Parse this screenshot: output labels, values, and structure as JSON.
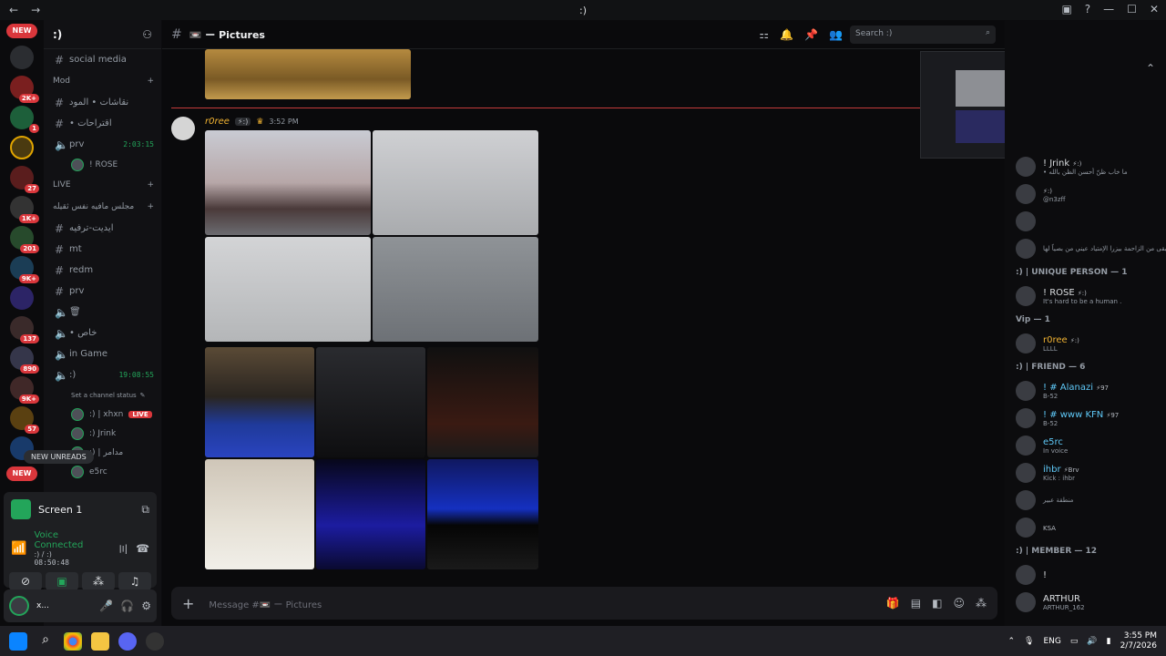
{
  "window": {
    "title": ":)",
    "back": "←",
    "forward": "→"
  },
  "servers": {
    "new_label": "NEW",
    "badges": [
      "2K+",
      "1",
      "27",
      "1K+",
      "201",
      "9K+",
      "137",
      "890",
      "9K+",
      "57"
    ]
  },
  "sidebar": {
    "server_name": ":)",
    "items": [
      {
        "type": "channel",
        "icon": "#",
        "name": "social media"
      },
      {
        "type": "category",
        "name": "Mod"
      },
      {
        "type": "channel",
        "icon": "#",
        "name": "نقاشات • المود"
      },
      {
        "type": "channel",
        "icon": "#",
        "name": "• اقتراحات"
      },
      {
        "type": "voice",
        "name": "prv",
        "time": "2:03:15"
      },
      {
        "type": "vuser",
        "name": "! ROSE"
      },
      {
        "type": "category",
        "name": "LIVE"
      },
      {
        "type": "category",
        "name": "مجلس مافيه نفس ثقيله"
      },
      {
        "type": "channel",
        "icon": "#",
        "name": "ايديت-ترفيه"
      },
      {
        "type": "channel",
        "icon": "#",
        "name": "mt"
      },
      {
        "type": "channel",
        "icon": "#",
        "name": "redm"
      },
      {
        "type": "channel",
        "icon": "#",
        "name": "prv"
      },
      {
        "type": "voice",
        "name": "🗑"
      },
      {
        "type": "voice",
        "name": "• خاص"
      },
      {
        "type": "voice",
        "name": "in Game"
      },
      {
        "type": "voice",
        "name": ":)",
        "time": "19:08:55"
      },
      {
        "type": "status",
        "name": "Set a channel status"
      },
      {
        "type": "vuser",
        "name": ":) | xhxn",
        "live": "LIVE"
      },
      {
        "type": "vuser",
        "name": ":) Jrink"
      },
      {
        "type": "vuser",
        "name": ":) | مدامر"
      },
      {
        "type": "vuser",
        "name": "e5rc"
      }
    ],
    "new_unreads": "NEW UNREADS"
  },
  "voice": {
    "screen_label": "Screen 1",
    "status": "Voice Connected",
    "channel": ":) / :)",
    "timer": "08:50:48"
  },
  "user": {
    "name": "x..."
  },
  "channel": {
    "name": "📼 ー Pictures",
    "search_placeholder": "Search :)"
  },
  "message": {
    "author": "r0ree",
    "tag": "⚡:)",
    "time": "3:52 PM"
  },
  "composer": {
    "placeholder": "Message #📼 ー Pictures"
  },
  "members": {
    "groups": [
      {
        "title": ":) | UNIQUE PERSON — 1",
        "members": [
          {
            "name": "! ROSE",
            "tag": "⚡:)",
            "status": "It's hard to be a human ."
          }
        ]
      },
      {
        "title": "Vip — 1",
        "members": [
          {
            "name": "r0ree",
            "tag": "⚡:)",
            "status": "LLLL"
          }
        ]
      },
      {
        "title": ":) | FRIEND — 6",
        "members": [
          {
            "name": "! # Alanazi",
            "tag": "⚡97",
            "status": "B-52"
          },
          {
            "name": "! # www KFN",
            "tag": "⚡97",
            "status": "B-52"
          },
          {
            "name": "e5rc",
            "tag": "",
            "status": "In voice"
          },
          {
            "name": "ihbr",
            "tag": "⚡Brv",
            "status": "Kick : ihbr"
          },
          {
            "name": "",
            "tag": "",
            "status": "منطقة عبير"
          },
          {
            "name": "",
            "tag": "KSA",
            "status": ""
          }
        ]
      },
      {
        "title": ":) | MEMBER — 12",
        "members": [
          {
            "name": "!",
            "tag": "",
            "status": ""
          },
          {
            "name": "ARTHUR",
            "tag": "",
            "status": "ARTHUR_162"
          }
        ]
      }
    ],
    "top_members": [
      {
        "name": "! Jrink",
        "tag": "⚡:)",
        "status": "• ما خاب ظنّ أحسن الظن بالله"
      },
      {
        "name": "",
        "tag": "⚡:)",
        "status": "@n3zff"
      },
      {
        "name": "",
        "tag": "",
        "status": ""
      },
      {
        "name": "",
        "tag": "",
        "status": "يبقى من الزاحمة بيزرا الإمتياد عيني من بصياً لها"
      }
    ]
  },
  "taskbar": {
    "lang": "ENG",
    "time": "3:55 PM",
    "date": "2/7/2026"
  }
}
